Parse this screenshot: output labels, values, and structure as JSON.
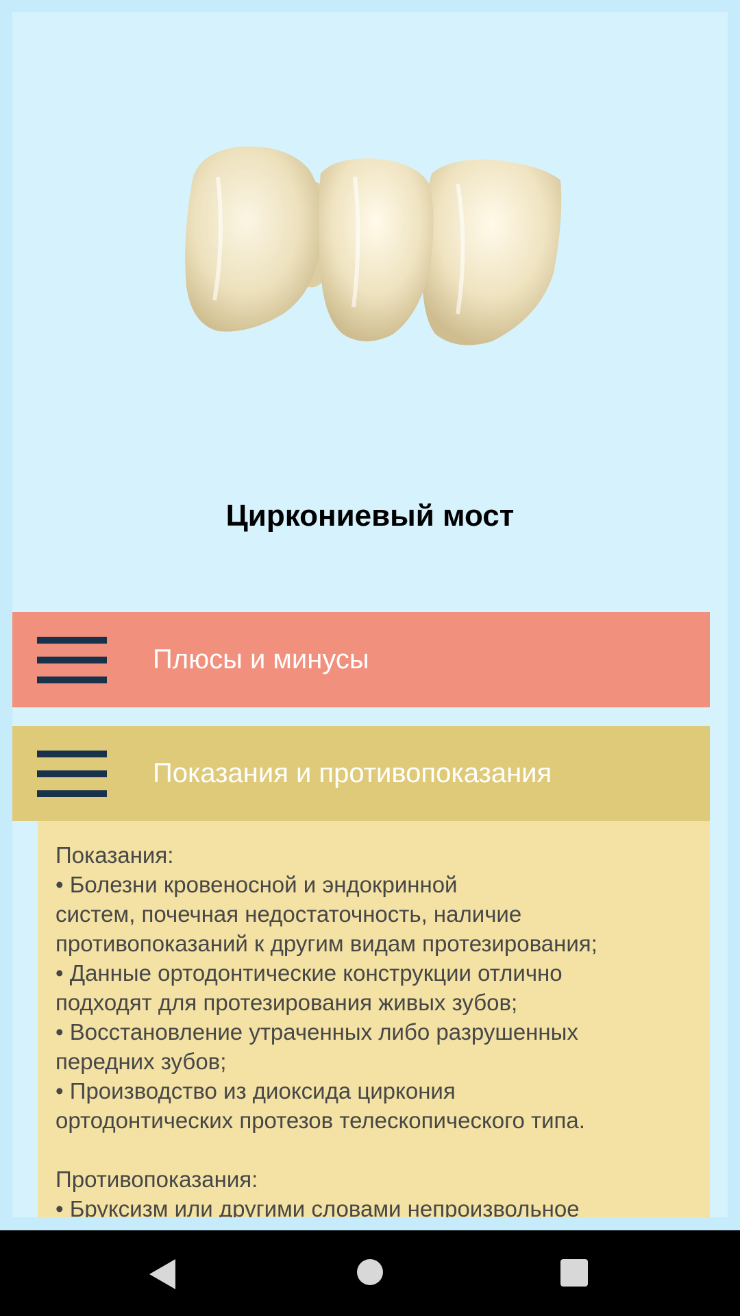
{
  "title": "Циркониевый мост",
  "hero_image": "zirconia-bridge-photo",
  "sections": [
    {
      "label": "Плюсы и минусы",
      "color": "#f2907e",
      "expanded": false
    },
    {
      "label": "Показания и противопоказания",
      "color": "#dfca7a",
      "expanded": true
    }
  ],
  "content": {
    "indications_heading": "Показания:",
    "lines": [
      "• Болезни кровеносной и эндокринной",
      "систем, почечная недостаточность, наличие",
      "противопоказаний к другим видам протезирования;",
      "• Данные ортодонтические конструкции отлично",
      "подходят для протезирования живых зубов;",
      "• Восстановление утраченных либо разрушенных",
      "передних зубов;",
      "• Производство из диоксида циркония",
      "ортодонтических протезов телескопического типа."
    ],
    "contraindications_heading": "Противопоказания:",
    "contraindications_first": "• Бруксизм или другими словами непроизвольное"
  },
  "navbar": {
    "back": "back-icon",
    "home": "home-icon",
    "recents": "recents-icon"
  }
}
